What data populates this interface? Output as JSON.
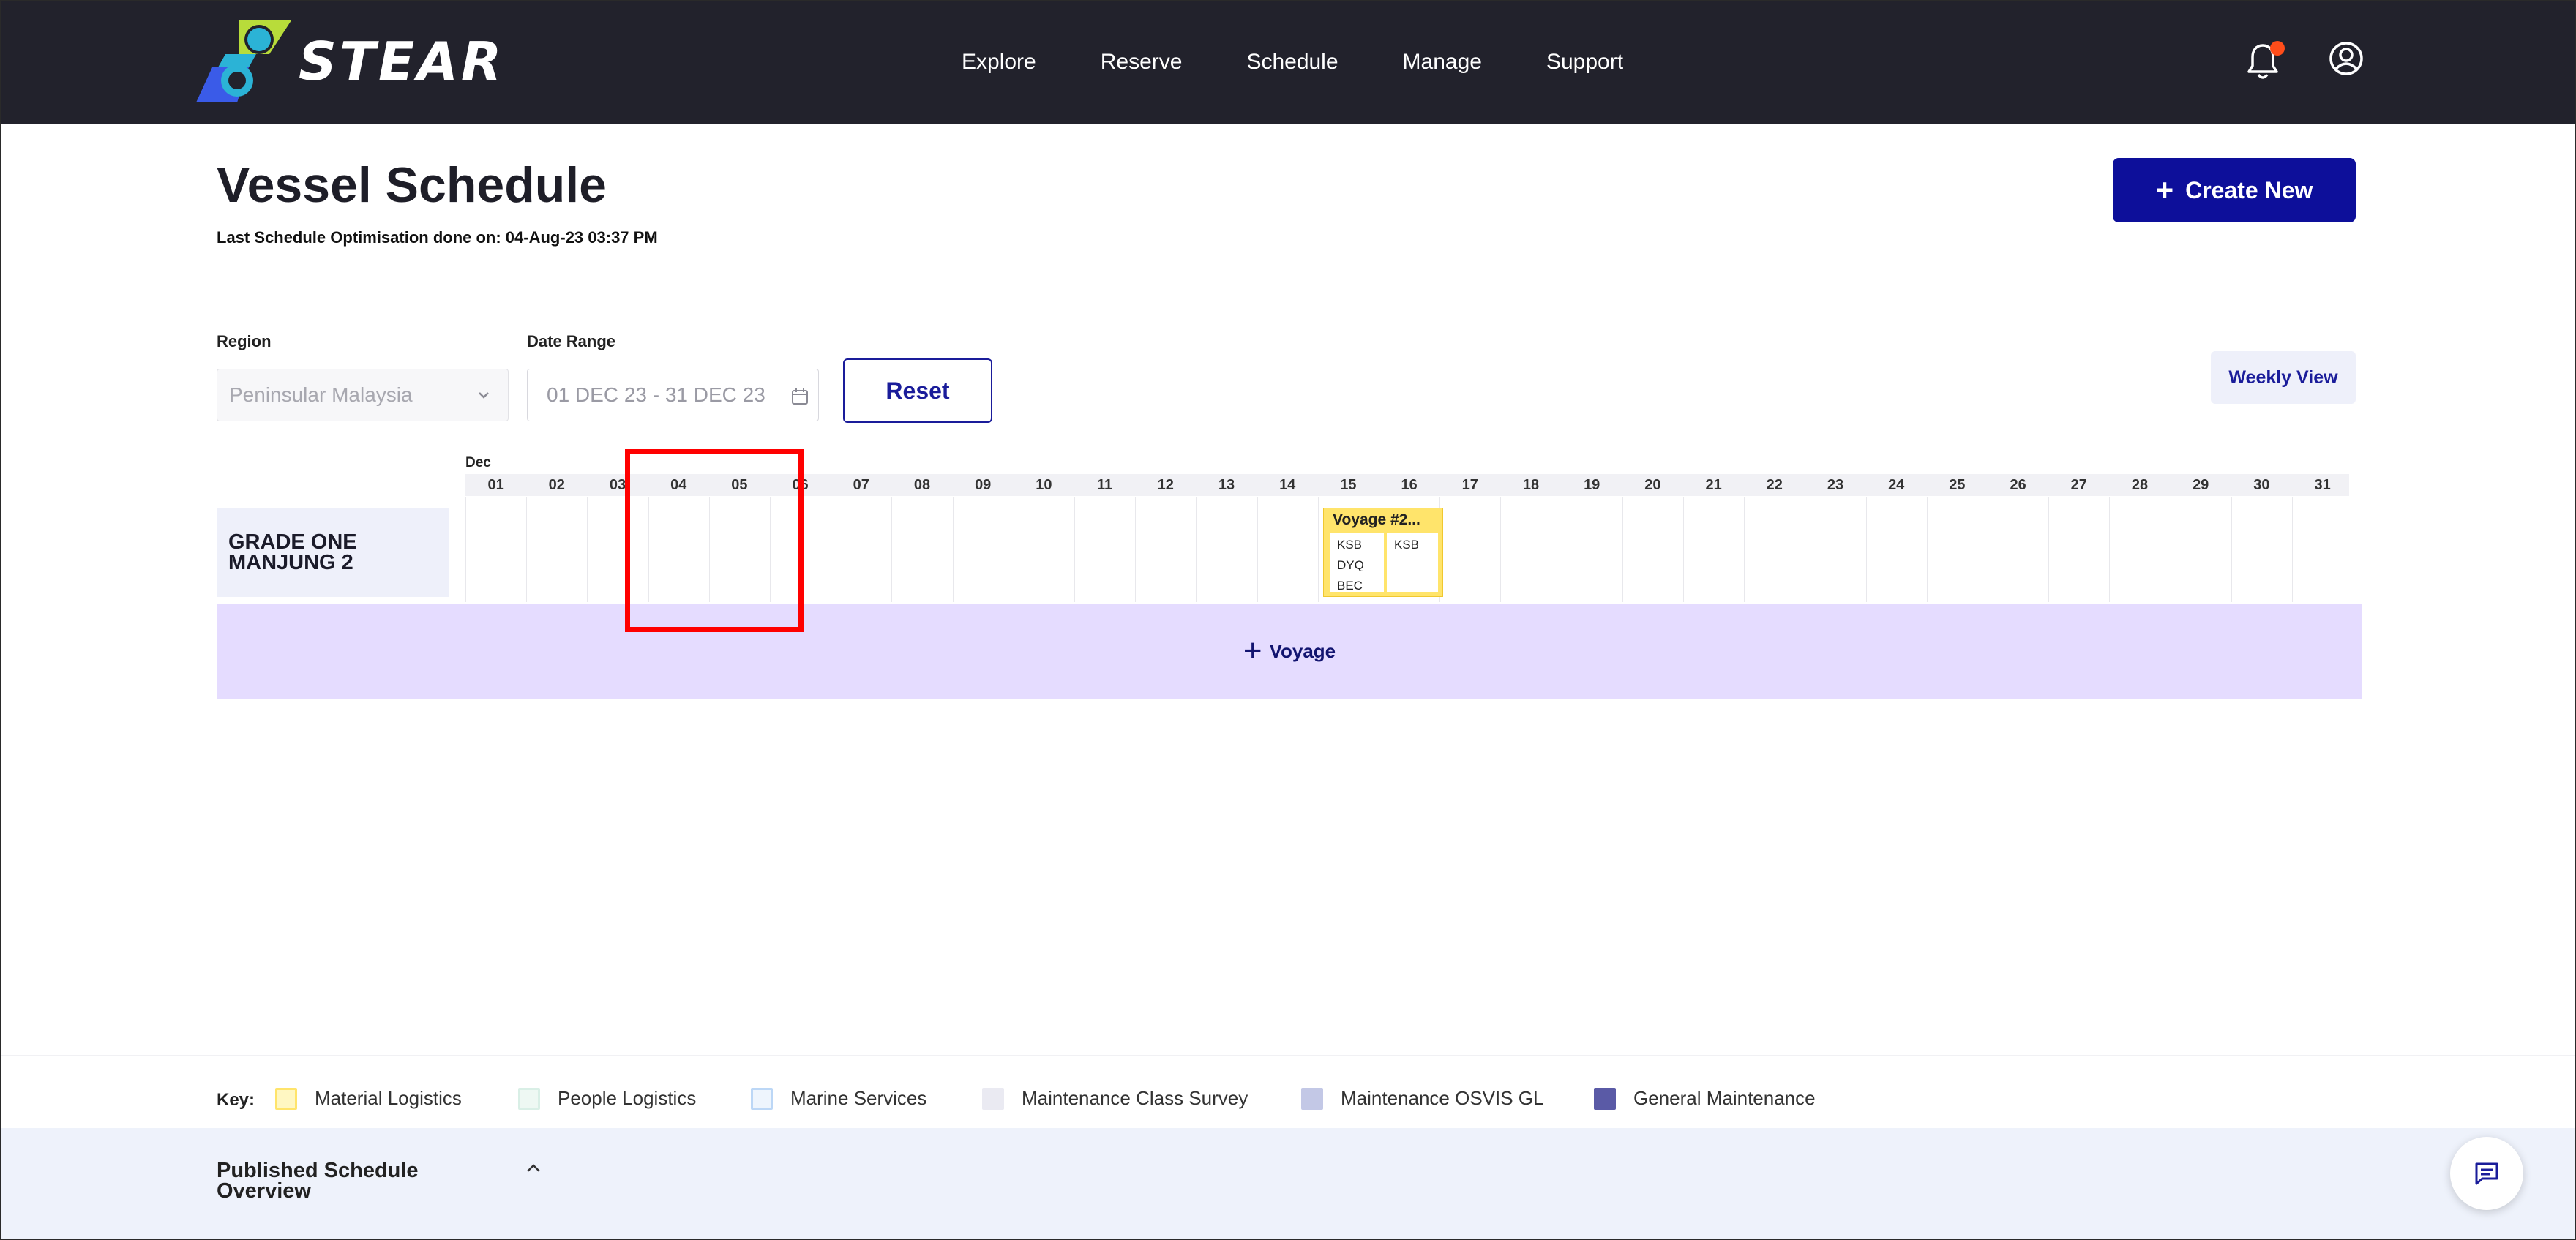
{
  "app": {
    "brand": "STEAR"
  },
  "nav": {
    "items": [
      "Explore",
      "Reserve",
      "Schedule",
      "Manage",
      "Support"
    ]
  },
  "page": {
    "title": "Vessel Schedule",
    "optimisation_text": "Last Schedule Optimisation done on: 04-Aug-23 03:37 PM",
    "create_label": "Create New"
  },
  "filters": {
    "region_label": "Region",
    "region_value": "Peninsular Malaysia",
    "date_label": "Date Range",
    "date_value": "01 DEC 23 - 31 DEC 23",
    "reset_label": "Reset",
    "weekly_label": "Weekly View"
  },
  "timeline": {
    "month": "Dec",
    "days": [
      "01",
      "02",
      "03",
      "04",
      "05",
      "06",
      "07",
      "08",
      "09",
      "10",
      "11",
      "12",
      "13",
      "14",
      "15",
      "16",
      "17",
      "18",
      "19",
      "20",
      "21",
      "22",
      "23",
      "24",
      "25",
      "26",
      "27",
      "28",
      "29",
      "30",
      "31"
    ]
  },
  "vessel": {
    "name_line1": "GRADE ONE",
    "name_line2": "MANJUNG 2"
  },
  "voyage": {
    "title": "Voyage #2...",
    "col1": [
      "KSB",
      "DYQ",
      "BEC"
    ],
    "col2": [
      "KSB"
    ]
  },
  "add_voyage_label": "Voyage",
  "key": {
    "title": "Key:",
    "items": [
      {
        "label": "Material Logistics",
        "color": "#ffe46b"
      },
      {
        "label": "People Logistics",
        "color": "#d9efe6"
      },
      {
        "label": "Marine Services",
        "color": "#d6e7fb"
      },
      {
        "label": "Maintenance Class Survey",
        "color": "#eaeaf2"
      },
      {
        "label": "Maintenance OSVIS GL",
        "color": "#c3c8e6"
      },
      {
        "label": "General Maintenance",
        "color": "#5a5aa6"
      }
    ]
  },
  "overview": {
    "line1": "Published Schedule",
    "line2": "Overview"
  },
  "colors": {
    "header": "#22222c",
    "accent": "#0d0f9a",
    "voyage_row": "#e5dcff",
    "notification": "#ff4d1a"
  }
}
